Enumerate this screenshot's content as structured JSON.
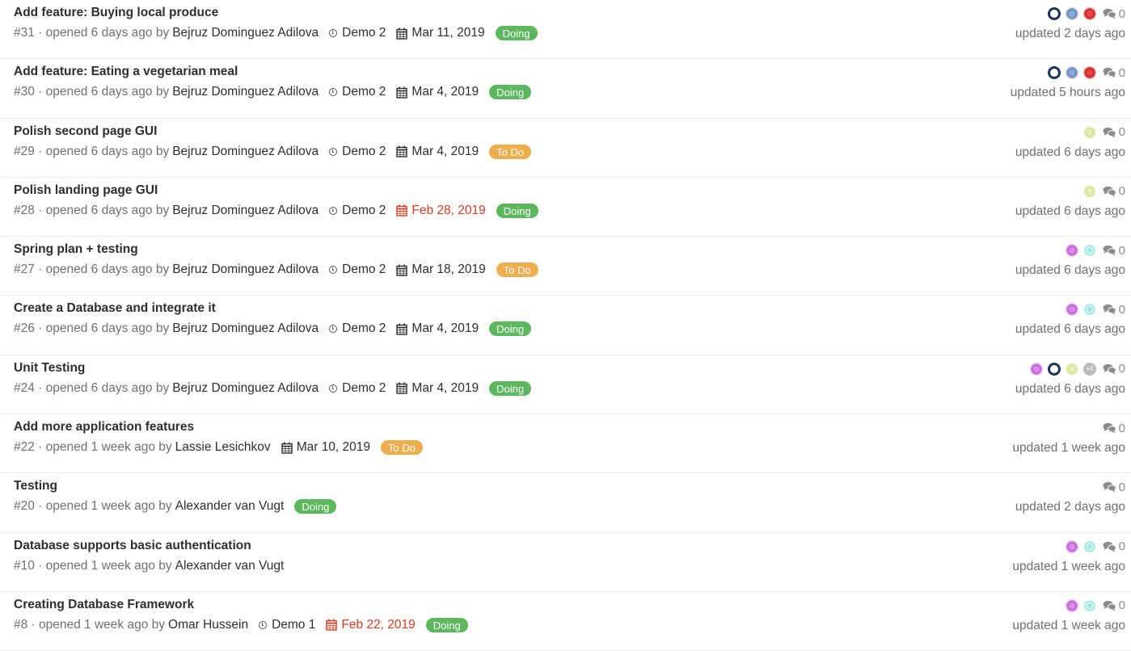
{
  "colors": {
    "doing": "#5cb85c",
    "todo": "#f0ad4e",
    "overdue": "#db3b21"
  },
  "issues": [
    {
      "title": "Add feature: Buying local produce",
      "ref": "#31",
      "opened": "opened 6 days ago by",
      "author": "Bejruz Dominguez Adilova",
      "milestone": "Demo 2",
      "due": "Mar 11, 2019",
      "due_overdue": false,
      "label": "Doing",
      "label_color": "#5cb85c",
      "assignees": [
        "navy-gear-avatar",
        "blue-pattern-avatar",
        "red-pattern-avatar"
      ],
      "comments": "0",
      "updated": "updated 2 days ago"
    },
    {
      "title": "Add feature: Eating a vegetarian meal",
      "ref": "#30",
      "opened": "opened 6 days ago by",
      "author": "Bejruz Dominguez Adilova",
      "milestone": "Demo 2",
      "due": "Mar 4, 2019",
      "due_overdue": false,
      "label": "Doing",
      "label_color": "#5cb85c",
      "assignees": [
        "navy-gear-avatar",
        "blue-pattern-avatar",
        "red-pattern-avatar"
      ],
      "comments": "0",
      "updated": "updated 5 hours ago"
    },
    {
      "title": "Polish second page GUI",
      "ref": "#29",
      "opened": "opened 6 days ago by",
      "author": "Bejruz Dominguez Adilova",
      "milestone": "Demo 2",
      "due": "Mar 4, 2019",
      "due_overdue": false,
      "label": "To Do",
      "label_color": "#f0ad4e",
      "assignees": [
        "lime-pattern-avatar"
      ],
      "comments": "0",
      "updated": "updated 6 days ago"
    },
    {
      "title": "Polish landing page GUI",
      "ref": "#28",
      "opened": "opened 6 days ago by",
      "author": "Bejruz Dominguez Adilova",
      "milestone": "Demo 2",
      "due": "Feb 28, 2019",
      "due_overdue": true,
      "label": "Doing",
      "label_color": "#5cb85c",
      "assignees": [
        "lime-pattern-avatar"
      ],
      "comments": "0",
      "updated": "updated 6 days ago"
    },
    {
      "title": "Spring plan + testing",
      "ref": "#27",
      "opened": "opened 6 days ago by",
      "author": "Bejruz Dominguez Adilova",
      "milestone": "Demo 2",
      "due": "Mar 18, 2019",
      "due_overdue": false,
      "label": "To Do",
      "label_color": "#f0ad4e",
      "assignees": [
        "purple-pattern-avatar",
        "teal-pattern-avatar"
      ],
      "comments": "0",
      "updated": "updated 6 days ago"
    },
    {
      "title": "Create a Database and integrate it",
      "ref": "#26",
      "opened": "opened 6 days ago by",
      "author": "Bejruz Dominguez Adilova",
      "milestone": "Demo 2",
      "due": "Mar 4, 2019",
      "due_overdue": false,
      "label": "Doing",
      "label_color": "#5cb85c",
      "assignees": [
        "purple-pattern-avatar",
        "teal-pattern-avatar"
      ],
      "comments": "0",
      "updated": "updated 6 days ago"
    },
    {
      "title": "Unit Testing",
      "ref": "#24",
      "opened": "opened 6 days ago by",
      "author": "Bejruz Dominguez Adilova",
      "milestone": "Demo 2",
      "due": "Mar 4, 2019",
      "due_overdue": false,
      "label": "Doing",
      "label_color": "#5cb85c",
      "assignees": [
        "purple-pattern-avatar",
        "navy-gear-avatar",
        "lime-pattern-avatar"
      ],
      "assignees_more": "+4",
      "comments": "0",
      "updated": "updated 6 days ago"
    },
    {
      "title": "Add more application features",
      "ref": "#22",
      "opened": "opened 1 week ago by",
      "author": "Lassie Lesichkov",
      "milestone": "",
      "due": "Mar 10, 2019",
      "due_overdue": false,
      "label": "To Do",
      "label_color": "#f0ad4e",
      "assignees": [],
      "comments": "0",
      "updated": "updated 1 week ago"
    },
    {
      "title": "Testing",
      "ref": "#20",
      "opened": "opened 1 week ago by",
      "author": "Alexander van Vugt",
      "milestone": "",
      "due": "",
      "due_overdue": false,
      "label": "Doing",
      "label_color": "#5cb85c",
      "assignees": [],
      "comments": "0",
      "updated": "updated 2 days ago"
    },
    {
      "title": "Database supports basic authentication",
      "ref": "#10",
      "opened": "opened 1 week ago by",
      "author": "Alexander van Vugt",
      "milestone": "",
      "due": "",
      "due_overdue": false,
      "label": "",
      "label_color": "",
      "assignees": [
        "purple-pattern-avatar",
        "teal-pattern-avatar"
      ],
      "comments": "0",
      "updated": "updated 1 week ago"
    },
    {
      "title": "Creating Database Framework",
      "ref": "#8",
      "opened": "opened 1 week ago by",
      "author": "Omar Hussein",
      "milestone": "Demo 1",
      "due": "Feb 22, 2019",
      "due_overdue": true,
      "label": "Doing",
      "label_color": "#5cb85c",
      "assignees": [
        "purple-pattern-avatar",
        "teal-pattern-avatar"
      ],
      "comments": "0",
      "updated": "updated 1 week ago"
    }
  ]
}
